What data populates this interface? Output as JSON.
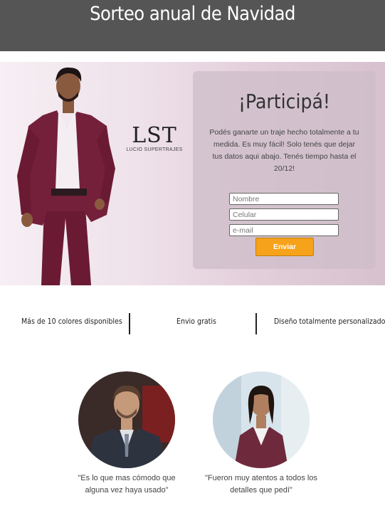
{
  "header": {
    "title": "Sorteo anual de Navidad",
    "bg_color": "#555555"
  },
  "hero": {
    "brand_logo": "LST",
    "brand_sub": "LUCIO SUPERTRAJES",
    "form": {
      "title": "¡Participá!",
      "text": "Podés ganarte un traje hecho totalmente a tu medida. Es muy fácil! Solo tenés que dejar tus datos aqui abajo. Tenés tiempo hasta el 20/12!",
      "fields": {
        "name_placeholder": "Nombre",
        "phone_placeholder": "Celular",
        "email_placeholder": "e-mail"
      },
      "submit_label": "Enviar",
      "button_color": "#f6a21a"
    }
  },
  "features": {
    "items": [
      "Más de 10 colores disponibles",
      "Envio gratis",
      "Diseño totalmente personalizado"
    ]
  },
  "testimonials": [
    {
      "quote": "\"Es lo que mas cómodo que alguna vez haya usado\""
    },
    {
      "quote": "\"Fueron muy atentos a todos los detalles que pedí\""
    }
  ]
}
